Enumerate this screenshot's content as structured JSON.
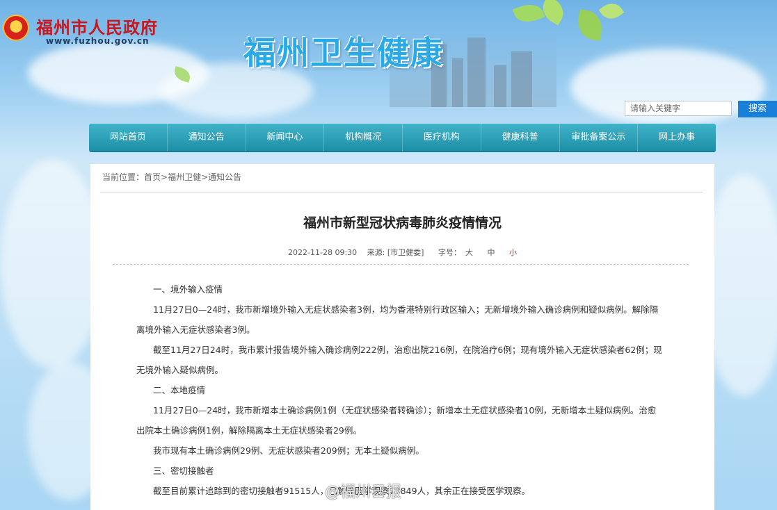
{
  "header": {
    "site_name": "福州市人民政府",
    "site_url": "www.fuzhou.gov.cn",
    "banner_title": "福州卫生健康"
  },
  "search": {
    "placeholder": "请输入关键字",
    "button_label": "搜索"
  },
  "nav": {
    "items": [
      {
        "label": "网站首页"
      },
      {
        "label": "通知公告"
      },
      {
        "label": "新闻中心"
      },
      {
        "label": "机构概况"
      },
      {
        "label": "医疗机构"
      },
      {
        "label": "健康科普"
      },
      {
        "label": "审批备案公示"
      },
      {
        "label": "网上办事"
      }
    ]
  },
  "breadcrumb": {
    "prefix": "当前位置：",
    "items": [
      "首页",
      "福州卫健",
      "通知公告"
    ],
    "separator": ">"
  },
  "article": {
    "title": "福州市新型冠状病毒肺炎疫情情况",
    "date": "2022-11-28 09:30",
    "source": "来源: [市卫健委]",
    "font_size_label": "字号：",
    "font_sizes": [
      "大",
      "中",
      "小"
    ],
    "paragraphs": [
      "一、境外输入疫情",
      "11月27日0—24时，我市新增境外输入无症状感染者3例，均为香港特别行政区输入；无新增境外输入确诊病例和疑似病例。解除隔离境外输入无症状感染者3例。",
      "截至11月27日24时，我市累计报告境外输入确诊病例222例，治愈出院216例，在院治疗6例；现有境外输入无症状感染者62例；现无境外输入疑似病例。",
      "二、本地疫情",
      "11月27日0—24时，我市新增本土确诊病例1例（无症状感染者转确诊）；新增本土无症状感染者10例，无新增本土疑似病例。治愈出院本土确诊病例1例，解除隔离本土无症状感染者29例。",
      "我市现有本土确诊病例29例、无症状感染者209例；无本土疑似病例。",
      "三、密切接触者",
      "截至目前累计追踪到的密切接触者91515人，已解除医学观察73849人，其余正在接受医学观察。"
    ]
  },
  "watermark": "@福州日报",
  "colors": {
    "nav_bg": "#1c8ea6",
    "search_button": "#1a7fd9",
    "site_name_red": "#c7161d",
    "banner_blue": "#29a9e5",
    "active_font_size": "#d0201a"
  }
}
